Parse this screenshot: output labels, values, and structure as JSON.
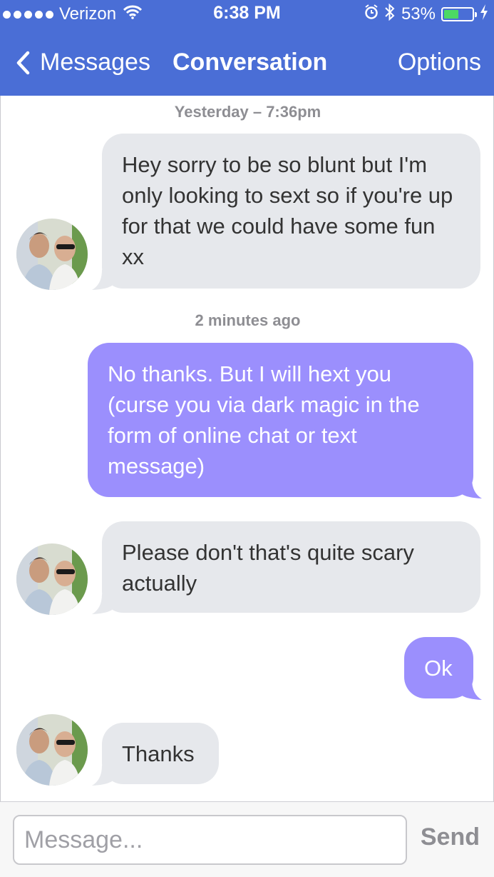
{
  "status_bar": {
    "carrier": "Verizon",
    "time": "6:38 PM",
    "battery_percent": "53%",
    "battery_level": 0.53,
    "signal_icon": "signal-dots-icon",
    "wifi_icon": "wifi-icon",
    "alarm_icon": "alarm-icon",
    "bluetooth_icon": "bluetooth-icon",
    "charging_icon": "charging-bolt-icon"
  },
  "nav": {
    "back_label": "Messages",
    "title": "Conversation",
    "options_label": "Options"
  },
  "conversation": {
    "timestamps": [
      "Yesterday – 7:36pm",
      "2 minutes ago"
    ],
    "messages": [
      {
        "direction": "incoming",
        "text": "Hey sorry to be so blunt but I'm only looking to sext so if you're up for that we could have some fun xx"
      },
      {
        "direction": "outgoing",
        "text": "No thanks. But I will hext you (curse you via dark magic in the form of online chat or text message)"
      },
      {
        "direction": "incoming",
        "text": "Please don't that's quite scary actually"
      },
      {
        "direction": "outgoing",
        "text": "Ok"
      },
      {
        "direction": "incoming",
        "text": "Thanks"
      }
    ]
  },
  "input_bar": {
    "placeholder": "Message...",
    "send_label": "Send"
  },
  "colors": {
    "header": "#4a6ed6",
    "incoming_bubble": "#e6e8ec",
    "outgoing_bubble": "#9b8ffd",
    "battery_fill": "#4cd964"
  }
}
